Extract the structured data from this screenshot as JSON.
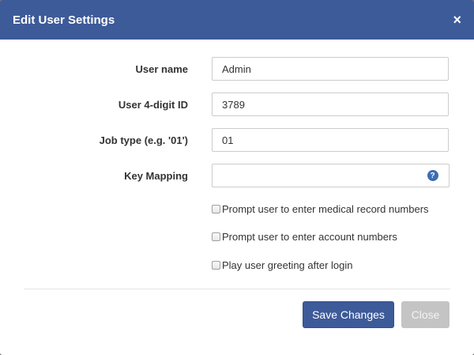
{
  "dialog": {
    "title": "Edit User Settings",
    "close_glyph": "×"
  },
  "fields": {
    "user_name": {
      "label": "User name",
      "value": "Admin"
    },
    "user_id": {
      "label": "User 4-digit ID",
      "value": "3789"
    },
    "job_type": {
      "label": "Job type (e.g. '01')",
      "value": "01"
    },
    "key_mapping": {
      "label": "Key Mapping",
      "value": "",
      "help_icon": "question-circle-icon",
      "help_glyph": "?"
    }
  },
  "options": {
    "prompt_mrn": {
      "label": "Prompt user to enter medical record numbers",
      "checked": false
    },
    "prompt_account": {
      "label": "Prompt user to enter account numbers",
      "checked": false
    },
    "play_greeting": {
      "label": "Play user greeting after login",
      "checked": false
    }
  },
  "footer": {
    "save_label": "Save Changes",
    "close_label": "Close"
  },
  "colors": {
    "header_bg": "#3d5a99",
    "primary_button": "#3d5a99",
    "disabled_button": "#c4c4c4"
  }
}
